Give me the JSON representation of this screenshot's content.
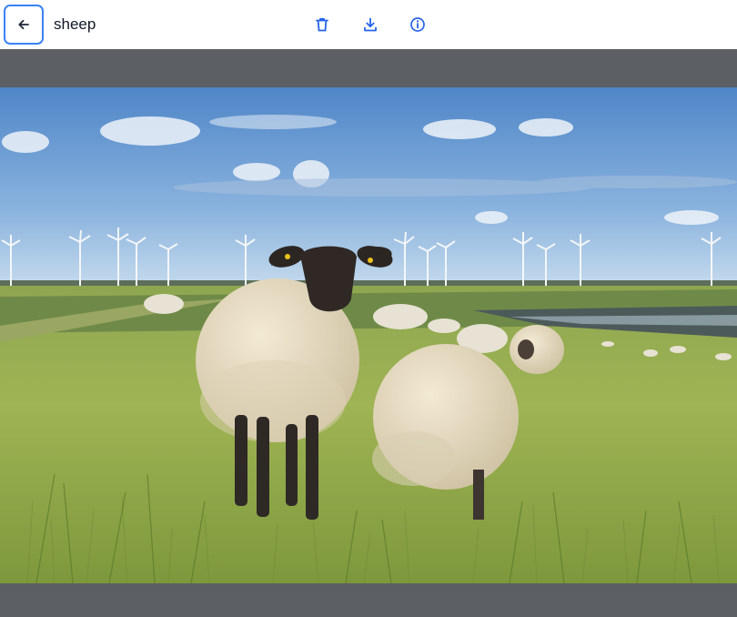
{
  "header": {
    "title": "sheep",
    "back_icon": "arrow-left-icon",
    "actions": [
      {
        "name": "delete-button",
        "icon": "trash-icon"
      },
      {
        "name": "download-button",
        "icon": "download-icon"
      },
      {
        "name": "info-button",
        "icon": "info-icon"
      }
    ]
  },
  "image": {
    "subject": "sheep"
  },
  "colors": {
    "accent": "#2563eb",
    "focus_ring": "#3b82f6",
    "backdrop": "#5a5d62"
  }
}
